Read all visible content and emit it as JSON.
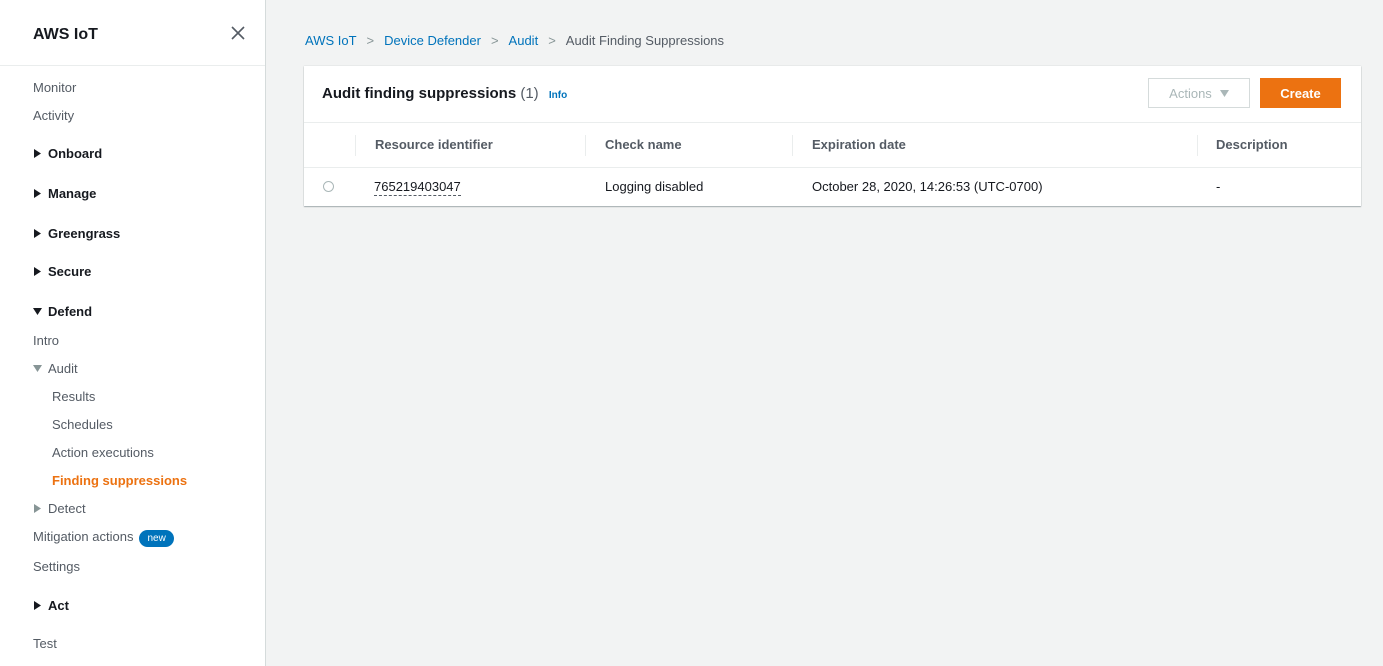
{
  "sidebar": {
    "title": "AWS IoT",
    "items": {
      "monitor": "Monitor",
      "activity": "Activity",
      "onboard": "Onboard",
      "manage": "Manage",
      "greengrass": "Greengrass",
      "secure": "Secure",
      "defend": "Defend",
      "intro": "Intro",
      "audit": "Audit",
      "results": "Results",
      "schedules": "Schedules",
      "action_executions": "Action executions",
      "finding_suppressions": "Finding suppressions",
      "detect": "Detect",
      "mitigation_actions": "Mitigation actions",
      "mitigation_badge": "new",
      "settings": "Settings",
      "act": "Act",
      "test": "Test"
    }
  },
  "breadcrumb": {
    "items": [
      "AWS IoT",
      "Device Defender",
      "Audit"
    ],
    "current": "Audit Finding Suppressions"
  },
  "panel": {
    "title": "Audit finding suppressions",
    "count": "(1)",
    "info": "Info",
    "actions_label": "Actions",
    "create_label": "Create"
  },
  "table": {
    "columns": [
      "Resource identifier",
      "Check name",
      "Expiration date",
      "Description"
    ],
    "rows": [
      {
        "resource_identifier": "765219403047",
        "check_name": "Logging disabled",
        "expiration_date": "October 28, 2020, 14:26:53 (UTC-0700)",
        "description": "-"
      }
    ]
  },
  "colors": {
    "accent": "#ec7211",
    "link": "#0073bb",
    "background": "#f2f3f3"
  },
  "icons": [
    "close-icon",
    "caret-right-icon",
    "caret-down-icon",
    "dropdown-triangle-icon",
    "radio-button"
  ]
}
